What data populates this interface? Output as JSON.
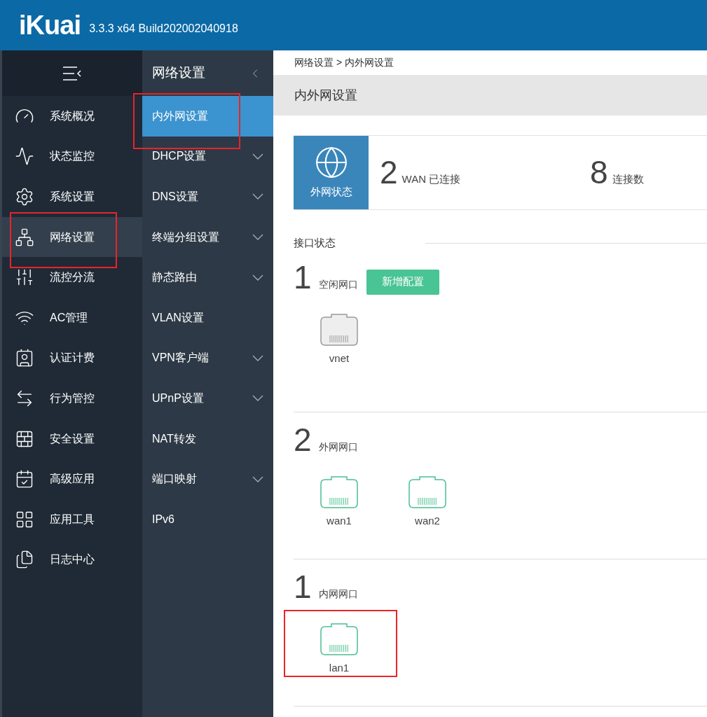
{
  "header": {
    "logo": "iKuai",
    "version": "3.3.3 x64 Build202002040918"
  },
  "sidebar": {
    "items": [
      {
        "label": "系统概况",
        "selected": false,
        "annotated": false
      },
      {
        "label": "状态监控",
        "selected": false,
        "annotated": false
      },
      {
        "label": "系统设置",
        "selected": false,
        "annotated": false
      },
      {
        "label": "网络设置",
        "selected": true,
        "annotated": true
      },
      {
        "label": "流控分流",
        "selected": false,
        "annotated": false
      },
      {
        "label": "AC管理",
        "selected": false,
        "annotated": false
      },
      {
        "label": "认证计费",
        "selected": false,
        "annotated": false
      },
      {
        "label": "行为管控",
        "selected": false,
        "annotated": false
      },
      {
        "label": "安全设置",
        "selected": false,
        "annotated": false
      },
      {
        "label": "高级应用",
        "selected": false,
        "annotated": false
      },
      {
        "label": "应用工具",
        "selected": false,
        "annotated": false
      },
      {
        "label": "日志中心",
        "selected": false,
        "annotated": false
      }
    ]
  },
  "submenu": {
    "title": "网络设置",
    "items": [
      {
        "label": "内外网设置",
        "selected": true,
        "expandable": false,
        "annotated": true
      },
      {
        "label": "DHCP设置",
        "selected": false,
        "expandable": true,
        "annotated": false
      },
      {
        "label": "DNS设置",
        "selected": false,
        "expandable": true,
        "annotated": false
      },
      {
        "label": "终端分组设置",
        "selected": false,
        "expandable": true,
        "annotated": false
      },
      {
        "label": "静态路由",
        "selected": false,
        "expandable": true,
        "annotated": false
      },
      {
        "label": "VLAN设置",
        "selected": false,
        "expandable": false,
        "annotated": false
      },
      {
        "label": "VPN客户端",
        "selected": false,
        "expandable": true,
        "annotated": false
      },
      {
        "label": "UPnP设置",
        "selected": false,
        "expandable": true,
        "annotated": false
      },
      {
        "label": "NAT转发",
        "selected": false,
        "expandable": false,
        "annotated": false
      },
      {
        "label": "端口映射",
        "selected": false,
        "expandable": true,
        "annotated": false
      },
      {
        "label": "IPv6",
        "selected": false,
        "expandable": false,
        "annotated": false
      }
    ]
  },
  "breadcrumb": "网络设置 > 内外网设置",
  "page_title": "内外网设置",
  "wan_status": {
    "label": "外网状态",
    "stats": [
      {
        "value": "2",
        "label": "WAN 已连接"
      },
      {
        "value": "8",
        "label": "连接数"
      }
    ]
  },
  "interface_status": {
    "title": "接口状态",
    "groups": [
      {
        "count": "1",
        "label": "空闲网口",
        "button": "新增配置",
        "ports": [
          {
            "name": "vnet",
            "connected": false,
            "annotated": false
          }
        ]
      },
      {
        "count": "2",
        "label": "外网网口",
        "ports": [
          {
            "name": "wan1",
            "connected": true,
            "annotated": false
          },
          {
            "name": "wan2",
            "connected": true,
            "annotated": false
          }
        ]
      },
      {
        "count": "1",
        "label": "内网网口",
        "ports": [
          {
            "name": "lan1",
            "connected": true,
            "annotated": true
          }
        ]
      }
    ]
  }
}
